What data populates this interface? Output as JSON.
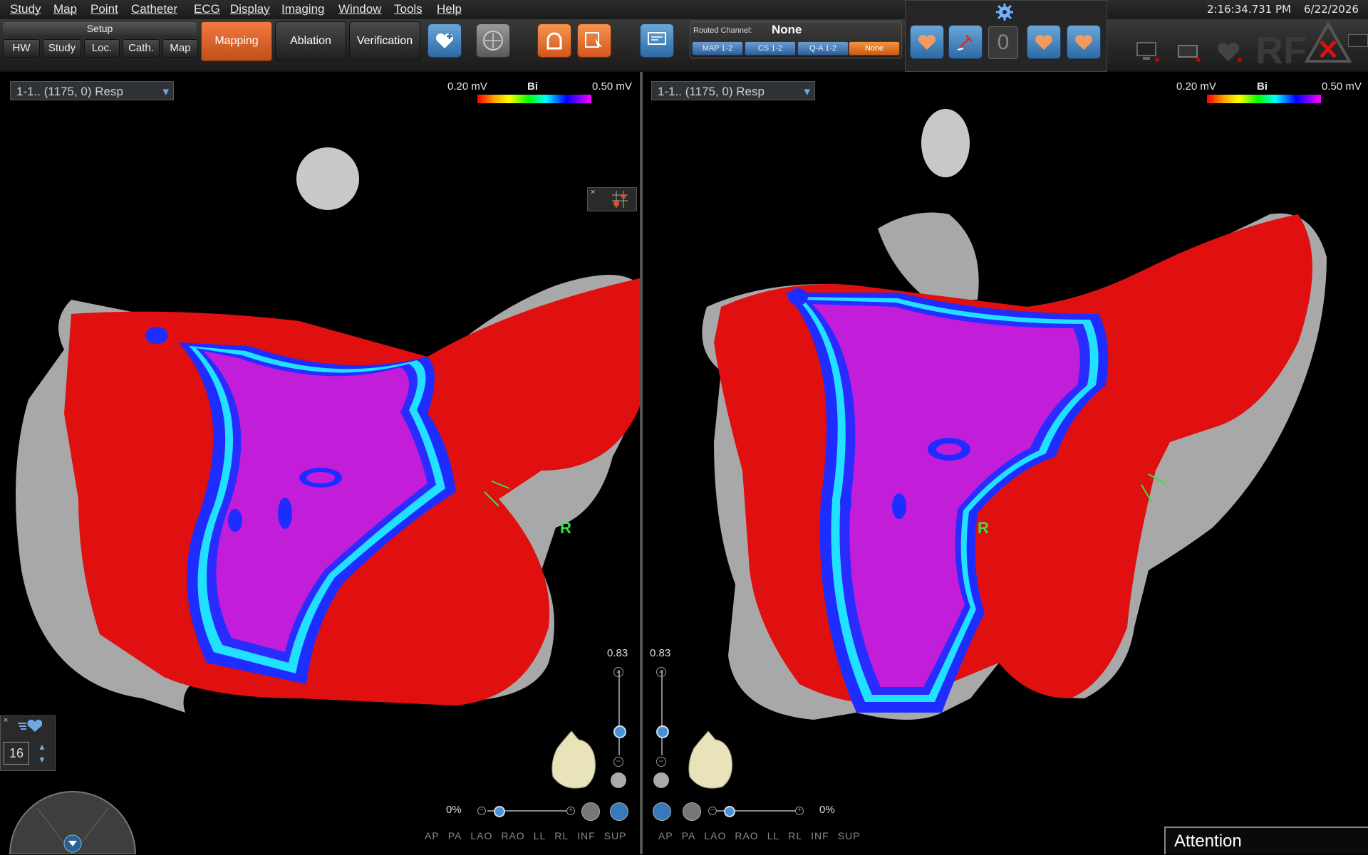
{
  "menu": [
    "Study",
    "Map",
    "Point",
    "Catheter",
    "ECG",
    "Display",
    "Imaging",
    "Window",
    "Tools",
    "Help"
  ],
  "clock": {
    "time": "2:16:34.731 PM",
    "date": "6/22/2026"
  },
  "setup": {
    "title": "Setup",
    "buttons": [
      "HW",
      "Study",
      "Loc.",
      "Cath.",
      "Map"
    ]
  },
  "modes": [
    "Mapping",
    "Ablation",
    "Verification"
  ],
  "routed": {
    "label": "Routed Channel:",
    "value": "None",
    "channels": [
      "MAP 1-2",
      "CS 1-2",
      "Q-A 1-2",
      "None"
    ],
    "selected": "None"
  },
  "counter": "0",
  "rf_label": "RF",
  "left_view": {
    "selector": "1-1.. (1175, 0) Resp",
    "scale_min": "0.20 mV",
    "scale_mode": "Bi",
    "scale_max": "0.50 mV",
    "r_label": "R",
    "zoom": "0.83",
    "opacity": "0%"
  },
  "right_view": {
    "selector": "1-1.. (1175, 0) Resp",
    "scale_min": "0.20 mV",
    "scale_mode": "Bi",
    "scale_max": "0.50 mV",
    "r_label": "R",
    "zoom": "0.83",
    "opacity": "0%"
  },
  "orientation": [
    "AP",
    "PA",
    "LAO",
    "RAO",
    "LL",
    "RL",
    "INF",
    "SUP"
  ],
  "point_size": "16",
  "attention": "Attention",
  "colors": {
    "accent_orange": "#d9632b",
    "map_red": "#e01010",
    "map_purple": "#c21dd8",
    "grey_surface": "#a8a8a8"
  }
}
